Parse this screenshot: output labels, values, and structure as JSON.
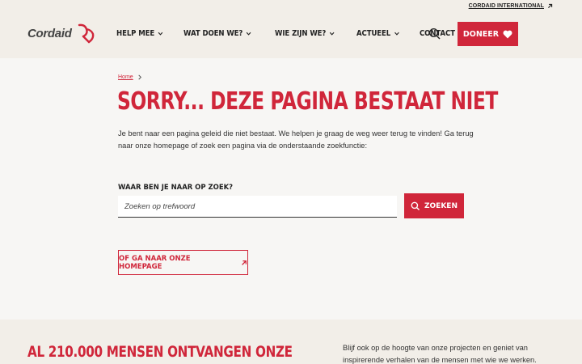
{
  "header": {
    "intl_link": "CORDAID INTERNATIONAL",
    "logo_text": "Cordaid",
    "nav": [
      {
        "label": "HELP MEE",
        "has_dropdown": true
      },
      {
        "label": "WAT DOEN WE?",
        "has_dropdown": true
      },
      {
        "label": "WIE ZIJN WE?",
        "has_dropdown": true
      },
      {
        "label": "ACTUEEL",
        "has_dropdown": true
      },
      {
        "label": "CONTACT",
        "has_dropdown": false
      }
    ],
    "donate_label": "DONEER",
    "icons": [
      "search-icon",
      "heart-icon",
      "arrow-up-right-icon",
      "chevron-down-icon"
    ]
  },
  "main": {
    "breadcrumb": {
      "home": "Home"
    },
    "title": "SORRY... DEZE PAGINA BESTAAT NIET",
    "intro": "Je bent naar een pagina geleid die niet bestaat. We helpen je graag de weg weer terug te vinden! Ga terug naar onze homepage of zoek een pagina via de onderstaande zoekfunctie:",
    "search": {
      "label": "WAAR BEN JE NAAR OP ZOEK?",
      "placeholder": "Zoeken op trefwoord",
      "submit_label": "ZOEKEN"
    },
    "home_button": "OF GA NAAR ONZE HOMEPAGE"
  },
  "bottom": {
    "heading": "AL 210.000 MENSEN ONTVANGEN ONZE",
    "text": "Blijf ook op de hoogte van onze projecten en geniet van inspirerende verhalen van de mensen met wie we werken."
  },
  "colors": {
    "accent": "#d0263a",
    "header_bg": "#f2eee8",
    "page_bg": "#f7f6f4"
  }
}
